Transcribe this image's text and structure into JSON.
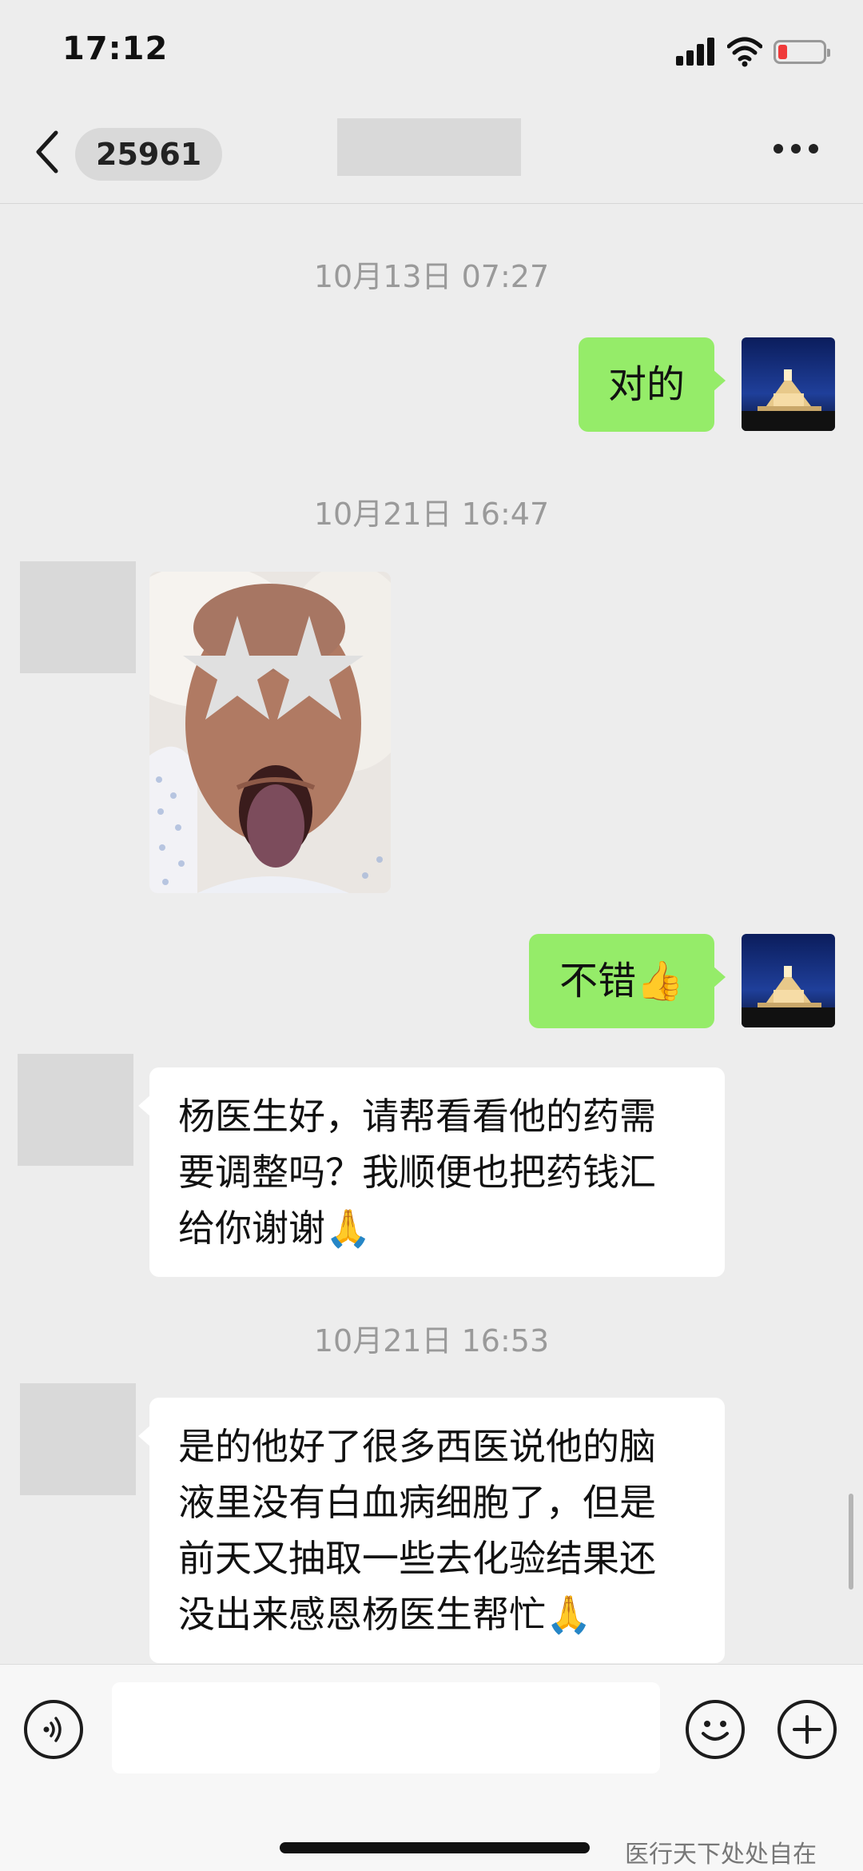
{
  "status_bar": {
    "time": "17:12",
    "battery_level": 0.2,
    "battery_color": "#f03a3a"
  },
  "header": {
    "unread_count": "25961"
  },
  "messages": {
    "t1": "10月13日 07:27",
    "m1": "对的",
    "t2": "10月21日 16:47",
    "m2_image": "patient-photo",
    "m3": "不错👍",
    "m4_line1": "杨医生好，请帮看看他的药需",
    "m4_line2": "要调整吗？我顺便也把药钱汇",
    "m4_line3": "给你谢谢🙏",
    "t3": "10月21日 16:53",
    "m5_line1": "是的他好了很多西医说他的脑",
    "m5_line2": "液里没有白血病细胞了，但是",
    "m5_line3": "前天又抽取一些去化验结果还",
    "m5_line4": "没出来感恩杨医生帮忙🙏"
  },
  "input_bar": {
    "voice_icon": "voice-icon",
    "emoji_icon": "emoji-icon",
    "plus_icon": "plus-icon"
  },
  "watermark": "医行天下处处自在",
  "colors": {
    "outgoing_bubble": "#95ec69",
    "incoming_bubble": "#ffffff",
    "background": "#ededed"
  }
}
